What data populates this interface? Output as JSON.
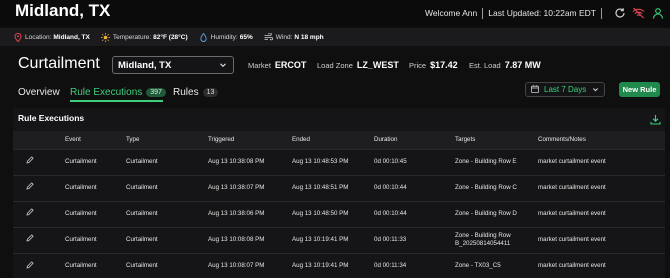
{
  "app": {
    "title": "Midland, TX",
    "welcome": "Welcome Ann",
    "last_updated": "Last Updated: 10:22am EDT"
  },
  "weather": {
    "location_label": "Location:",
    "location_value": "Midland, TX",
    "temperature_label": "Temperature:",
    "temperature_value": "82°F (28°C)",
    "humidity_label": "Humidity:",
    "humidity_value": "65%",
    "wind_label": "Wind:",
    "wind_value": "N 18 mph"
  },
  "header": {
    "title": "Curtailment",
    "location_select": "Midland, TX",
    "market_label": "Market",
    "market_value": "ERCOT",
    "load_zone_label": "Load Zone",
    "load_zone_value": "LZ_WEST",
    "price_label": "Price",
    "price_value": "$17.42",
    "est_load_label": "Est. Load",
    "est_load_value": "7.87 MW"
  },
  "tabs": [
    {
      "label": "Overview",
      "count": ""
    },
    {
      "label": "Rule Executions",
      "count": "397"
    },
    {
      "label": "Rules",
      "count": "13"
    }
  ],
  "date_range": "Last 7 Days",
  "new_rule_label": "New Rule",
  "section": {
    "title": "Rule Executions",
    "columns": [
      "Event",
      "Type",
      "Triggered",
      "Ended",
      "Duration",
      "Targets",
      "Comments/Notes"
    ],
    "rows": [
      {
        "event": "Curtailment",
        "type": "Curtailment",
        "triggered": "Aug 13 10:38:08 PM",
        "ended": "Aug 13 10:48:53 PM",
        "duration": "0d 00:10:45",
        "targets": "Zone - Building Row E",
        "notes": "market curtailment event"
      },
      {
        "event": "Curtailment",
        "type": "Curtailment",
        "triggered": "Aug 13 10:38:07 PM",
        "ended": "Aug 13 10:48:51 PM",
        "duration": "0d 00:10:44",
        "targets": "Zone - Building Row C",
        "notes": "market curtailment event"
      },
      {
        "event": "Curtailment",
        "type": "Curtailment",
        "triggered": "Aug 13 10:38:06 PM",
        "ended": "Aug 13 10:48:50 PM",
        "duration": "0d 00:10:44",
        "targets": "Zone - Building Row D",
        "notes": "market curtailment event"
      },
      {
        "event": "Curtailment",
        "type": "Curtailment",
        "triggered": "Aug 13 10:08:08 PM",
        "ended": "Aug 13 10:19:41 PM",
        "duration": "0d 00:11:33",
        "targets": "Zone - Building Row B_20250814054411",
        "notes": "market curtailment event"
      },
      {
        "event": "Curtailment",
        "type": "Curtailment",
        "triggered": "Aug 13 10:08:07 PM",
        "ended": "Aug 13 10:19:41 PM",
        "duration": "0d 00:11:34",
        "targets": "Zone - TX03_C5",
        "notes": "market curtailment event"
      }
    ]
  },
  "colors": {
    "accent": "#3ecf7a",
    "alert": "#e0454f",
    "button": "#1f8a4c"
  },
  "icons": [
    "refresh-icon",
    "wifi-off-icon",
    "user-icon",
    "location-pin-icon",
    "sun-icon",
    "droplet-icon",
    "wind-icon",
    "chevron-down-icon",
    "calendar-icon",
    "download-icon",
    "pencil-icon"
  ]
}
